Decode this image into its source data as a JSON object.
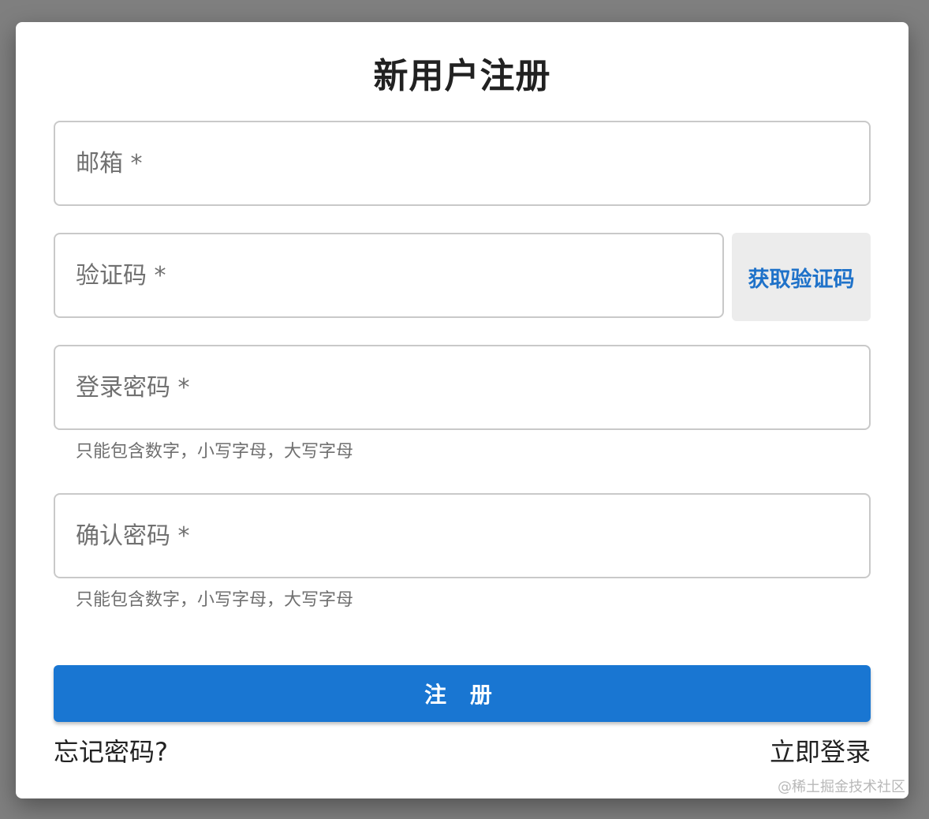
{
  "dialog": {
    "title": "新用户注册"
  },
  "fields": {
    "email": {
      "placeholder": "邮箱 *",
      "value": ""
    },
    "code": {
      "placeholder": "验证码 *",
      "value": ""
    },
    "password": {
      "placeholder": "登录密码 *",
      "value": "",
      "helper": "只能包含数字，小写字母，大写字母"
    },
    "confirm": {
      "placeholder": "确认密码 *",
      "value": "",
      "helper": "只能包含数字，小写字母，大写字母"
    }
  },
  "buttons": {
    "get_code": "获取验证码",
    "register": "注 册"
  },
  "links": {
    "forgot": "忘记密码?",
    "login": "立即登录"
  },
  "watermark": "@稀土掘金技术社区",
  "colors": {
    "primary": "#1976d2",
    "link_blue": "#1f72c9",
    "overlay": "#7f7f7f"
  }
}
